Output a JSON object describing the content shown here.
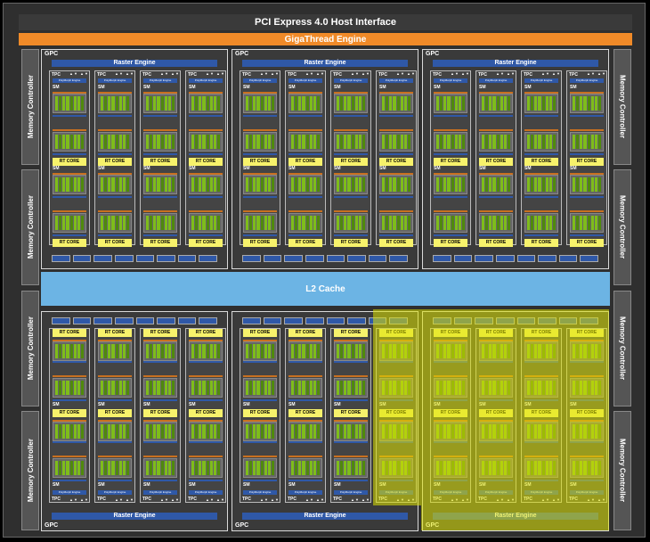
{
  "pci_label": "PCI Express 4.0 Host Interface",
  "gigathread_label": "GigaThread Engine",
  "l2_label": "L2 Cache",
  "memory_controller_label": "Memory Controller",
  "gpc_label": "GPC",
  "raster_label": "Raster Engine",
  "tpc_label": "TPC",
  "polymorph_label": "PolyMorph Engine",
  "sm_label": "SM",
  "rt_core_label": "RT CORE",
  "highlight_color": "#dee400",
  "accent_orange": "#f08a28",
  "accent_blue": "#2f58a7",
  "cache_color": "#6cb4e4",
  "tensor_green": "#7ebd1a",
  "rt_yellow": "#f7f26b"
}
